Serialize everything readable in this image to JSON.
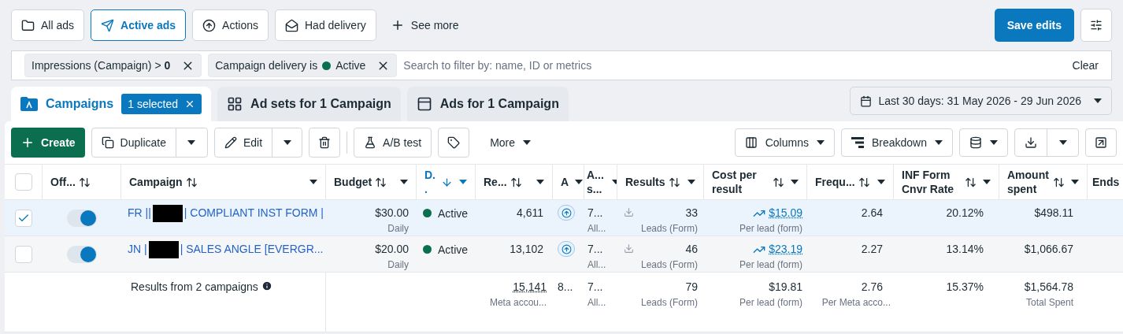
{
  "view_buttons": [
    {
      "kind": "folder",
      "label": "All ads",
      "selected": false
    },
    {
      "kind": "send",
      "label": "Active ads",
      "selected": true
    },
    {
      "kind": "actions",
      "label": "Actions",
      "selected": false
    },
    {
      "kind": "mail",
      "label": "Had delivery",
      "selected": false
    }
  ],
  "see_more": "See more",
  "save_button": "Save edits",
  "filters": [
    {
      "label": "Impressions (Campaign) > **0**"
    },
    {
      "label": "Campaign delivery is",
      "color": "#0b6e4f",
      "value": "Active"
    }
  ],
  "search": {
    "placeholder": "Search to filter by: name, ID or metrics"
  },
  "clear": "Clear",
  "tabs": [
    {
      "kind": "campaigns",
      "label": "Campaigns",
      "selected": true,
      "badge": "1 selected"
    },
    {
      "kind": "adsets",
      "label": "Ad sets for 1 Campaign",
      "selected": false
    },
    {
      "kind": "ads",
      "label": "Ads for 1 Campaign",
      "selected": false
    }
  ],
  "date_range": "Last 30 days: 31 May 2026 - 29 Jun 2026",
  "toolbar": {
    "create": "Create",
    "duplicate": "Duplicate",
    "edit": "Edit",
    "ab_test": "A/B test",
    "more": "More",
    "columns": "Columns",
    "breakdown": "Breakdown"
  },
  "table": {
    "all_selected": false,
    "columns": [
      {
        "label": "Off...",
        "sorted": false,
        "menu": false
      },
      {
        "label": "Campaign",
        "sorted": false,
        "menu": true
      },
      {
        "label": "Budget",
        "sorted": false,
        "menu": true
      },
      {
        "label": "D..",
        "sorted": true,
        "menu": true
      },
      {
        "label": "Re...",
        "sorted": false,
        "menu": true
      },
      {
        "label": "A",
        "sorted": false,
        "menu": true
      },
      {
        "label": "A... s...",
        "sorted": false,
        "menu": true
      },
      {
        "label": "Results",
        "sorted": false,
        "menu": true
      },
      {
        "label": "Cost per result",
        "sorted": false,
        "menu": true
      },
      {
        "label": "Frequ...",
        "sorted": false,
        "menu": true
      },
      {
        "label": "INF Form Cnvr Rate",
        "sorted": false,
        "menu": true
      },
      {
        "label": "Amount spent",
        "sorted": false,
        "menu": true
      },
      {
        "label": "Ends",
        "sorted": false,
        "menu": false
      }
    ],
    "rows": [
      {
        "selected": true,
        "on": true,
        "name_prefix": "FR ||",
        "name_suffix": "| COMPLIANT INST FORM |",
        "budget": "$30.00",
        "budget_period": "Daily",
        "delivery": "Active",
        "color": "#0b6e4f",
        "reach": "4,611",
        "audience": "7...",
        "audience_sub": "All...",
        "results": "33",
        "results_type": "Leads (Form)",
        "cost": "$15.09",
        "cost_type": "Per lead (form)",
        "frequency": "2.64",
        "rate": "20.12%",
        "spent": "$498.11"
      },
      {
        "selected": false,
        "on": true,
        "name_prefix": "JN |",
        "name_suffix": "| SALES ANGLE [EVERGR...",
        "budget": "$20.00",
        "budget_period": "Daily",
        "delivery": "Active",
        "color": "#0b6e4f",
        "reach": "13,102",
        "audience": "7...",
        "audience_sub": "All...",
        "results": "46",
        "results_type": "Leads (Form)",
        "cost": "$23.19",
        "cost_type": "Per lead (form)",
        "frequency": "2.27",
        "rate": "13.14%",
        "spent": "$1,066.67"
      }
    ],
    "total": {
      "label": "Results from 2 campaigns",
      "reach": "15,141",
      "reach_sub": "Meta accou...",
      "col_a": "8...",
      "audience": "7...",
      "audience_sub": "All...",
      "results": "79",
      "results_type": "Leads (Form)",
      "cost": "$19.81",
      "cost_type": "Per lead (form)",
      "frequency": "2.76",
      "frequency_sub": "Per Meta acco...",
      "rate": "15.37%",
      "spent": "$1,564.78",
      "spent_sub": "Total Spent"
    }
  }
}
